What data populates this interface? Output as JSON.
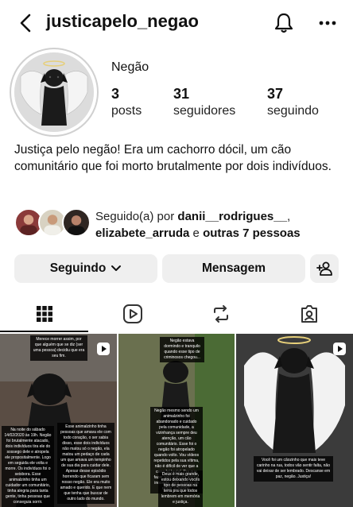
{
  "header": {
    "username": "justicapelo_negao",
    "icons": [
      "back-arrow-icon",
      "bell-icon",
      "more-options-icon"
    ]
  },
  "profile": {
    "name": "Negão",
    "stats": [
      {
        "value": "3",
        "label": "posts"
      },
      {
        "value": "31",
        "label": "seguidores"
      },
      {
        "value": "37",
        "label": "seguindo"
      }
    ],
    "bio": "Justiça pelo negão! Era um cachorro dócil, um cão comunitário que foi morto brutalmente por dois indivíduos."
  },
  "followed_by": {
    "prefix": "Seguido(a) por ",
    "user1": "danii__rodrigues__",
    "sep": ",",
    "user2": "elizabete_arruda",
    "middle": " e ",
    "others": "outras 7 pessoas"
  },
  "actions": {
    "follow_label": "Seguindo",
    "message_label": "Mensagem"
  },
  "tabs": [
    "grid-icon",
    "reels-icon",
    "reposts-icon",
    "tagged-icon"
  ],
  "posts": [
    {
      "caption_top": "Merece morrer assim, por que alguém que se diz (ser uma pessoa) decidiu que era seu fim.",
      "caption_left": "Na noite do sábado 14/02/2020 às 19h. Negão foi brutalmente atacado, dois indivíduos tira ele do sossego dele e atropela ele propositalmente. Logo em seguida ele volta e morre. Os indivíduos foi o seisbora. Esse animalzinho tinha um cuidador um comunitário, tinha alegria para tanta gente, tinha pessoas que conseguia sorrir.",
      "caption_right": "Esse animalzinho tinha pessoas que amava ele com todo coração, o ser sabia disso, esse dois indivíduos não matou só o negão, ela matou um pedaço de cada um que amava um tempinho de sua dia para cuidar dele. Apesar desse episódio horrendo que ficaram sem nosso negão. Ele era muito amado e querido. E que nem que tenha que buscar de outro lado do mundo."
    },
    {
      "caption_top": "Negão estava dormindo e tranquilo quando esse tipo de criminosos chegou...",
      "caption_mid": "Negão mesmo sendo um animalzinho foi abandonado e cuidado pela comunidade, a vizinhança sempre deu atenção, um cão comunitário. Esse foi o negão foi atropelado quando volto. Vou vídeos repetidos pela sua vítima, não é difícil de ver que a cena foi brutal. Pra que fazer isso com um animal inocente, sem chance de reagir a mesmo.",
      "caption_bottom": "Deus é mais grande, estou deixando vocês tipo de pessoas na terra pra que todos lembrem em memória e justiça."
    },
    {
      "caption_bottom": "Você foi um cãozinho que mais teve carinho na rua, todos vão sentir falta, não vai deixar de ser lembrado. Descanse em paz, negão. Justiça!"
    }
  ],
  "colors": {
    "button_bg": "#efefef",
    "text": "#111111",
    "link_blue": "#0095f6"
  }
}
